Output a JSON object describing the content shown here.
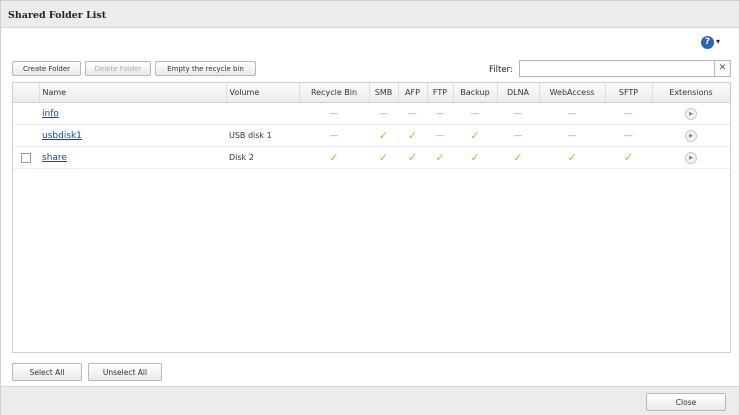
{
  "dialog": {
    "title": "Shared Folder List",
    "help_icon": "help-circle-icon",
    "help_glyph": "?",
    "caret_glyph": "▾"
  },
  "toolbar": {
    "create_folder": "Create Folder",
    "delete_folder": "Delete Folder",
    "empty_recycle": "Empty the recycle bin",
    "filter_label": "Filter:",
    "filter_value": "",
    "filter_clear": "✕"
  },
  "table": {
    "columns": [
      "Name",
      "Volume",
      "Recycle Bin",
      "SMB",
      "AFP",
      "FTP",
      "Backup",
      "DLNA",
      "WebAccess",
      "SFTP",
      "Extensions"
    ],
    "rows": [
      {
        "has_checkbox": false,
        "name": "info",
        "volume": "",
        "recycle_bin": "—",
        "smb": "—",
        "afp": "—",
        "ftp": "—",
        "backup": "—",
        "dlna": "—",
        "webaccess": "—",
        "sftp": "—"
      },
      {
        "has_checkbox": false,
        "name": "usbdisk1",
        "volume": "USB disk 1",
        "recycle_bin": "—",
        "smb": "✓",
        "afp": "✓",
        "ftp": "—",
        "backup": "✓",
        "dlna": "—",
        "webaccess": "—",
        "sftp": "—"
      },
      {
        "has_checkbox": true,
        "name": "share",
        "volume": "Disk 2",
        "recycle_bin": "✓",
        "smb": "✓",
        "afp": "✓",
        "ftp": "✓",
        "backup": "✓",
        "dlna": "✓",
        "webaccess": "✓",
        "sftp": "✓"
      }
    ],
    "extension_glyph": "▶"
  },
  "footer": {
    "select_all": "Select All",
    "unselect_all": "Unselect All",
    "close": "Close"
  },
  "colors": {
    "check": "#e8a32e",
    "link": "#1a3fbf",
    "help": "#2a63b8"
  }
}
